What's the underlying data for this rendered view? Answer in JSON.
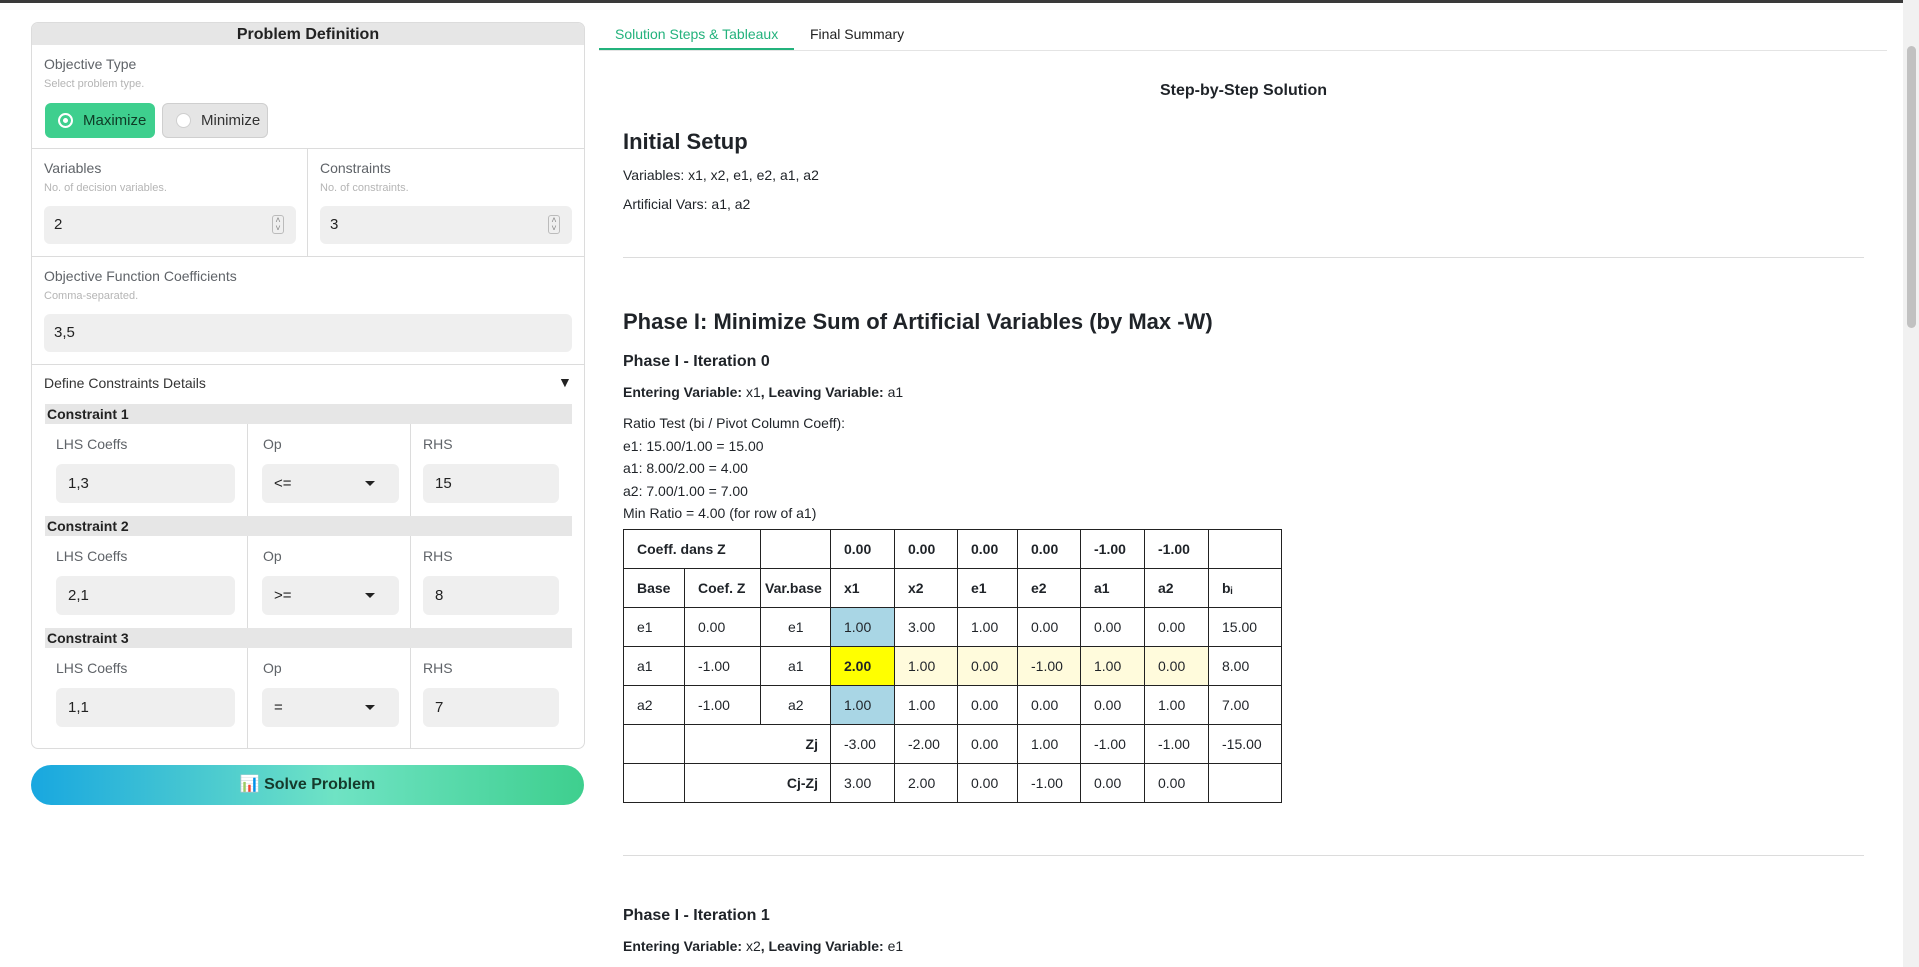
{
  "problem": {
    "title": "Problem Definition",
    "objective_type": {
      "label": "Objective Type",
      "hint": "Select problem type.",
      "maximize": "Maximize",
      "minimize": "Minimize",
      "selected": "Maximize"
    },
    "variables": {
      "label": "Variables",
      "hint": "No. of decision variables.",
      "value": "2"
    },
    "constraints": {
      "label": "Constraints",
      "hint": "No. of constraints.",
      "value": "3"
    },
    "objective_coeffs": {
      "label": "Objective Function Coefficients",
      "hint": "Comma-separated.",
      "value": "3,5"
    },
    "details_label": "Define Constraints Details",
    "details_toggle": "▼",
    "constraint_rows": [
      {
        "title": "Constraint 1",
        "lhs_label": "LHS Coeffs",
        "lhs": "1,3",
        "op_label": "Op",
        "op": "<=",
        "rhs_label": "RHS",
        "rhs": "15"
      },
      {
        "title": "Constraint 2",
        "lhs_label": "LHS Coeffs",
        "lhs": "2,1",
        "op_label": "Op",
        "op": ">=",
        "rhs_label": "RHS",
        "rhs": "8"
      },
      {
        "title": "Constraint 3",
        "lhs_label": "LHS Coeffs",
        "lhs": "1,1",
        "op_label": "Op",
        "op": "=",
        "rhs_label": "RHS",
        "rhs": "7"
      }
    ],
    "solve_button": "📊 Solve Problem"
  },
  "tabs": {
    "steps": "Solution Steps & Tableaux",
    "summary": "Final Summary",
    "active": "steps"
  },
  "solution": {
    "heading": "Step-by-Step Solution",
    "initial_setup": {
      "title": "Initial Setup",
      "variables": "Variables: x1, x2, e1, e2, a1, a2",
      "artificial": "Artificial Vars: a1, a2"
    },
    "phase1_title": "Phase I: Minimize Sum of Artificial Variables (by Max -W)",
    "iter0": {
      "title": "Phase I - Iteration 0",
      "entering_label": "Entering Variable:",
      "entering": "x1",
      "leaving_label": "Leaving Variable:",
      "leaving": "a1",
      "ratio_lines": [
        "Ratio Test (bi / Pivot Column Coeff):",
        "e1: 15.00/1.00 = 15.00",
        "a1: 8.00/2.00 = 4.00",
        "a2: 7.00/1.00 = 7.00",
        "Min Ratio = 4.00 (for row of a1)"
      ],
      "table": {
        "coeff_label": "Coeff. dans Z",
        "coeffs": [
          "0.00",
          "0.00",
          "0.00",
          "0.00",
          "-1.00",
          "-1.00"
        ],
        "headers": [
          "Base",
          "Coef. Z",
          "Var.base",
          "x1",
          "x2",
          "e1",
          "e2",
          "a1",
          "a2",
          "bᵢ"
        ],
        "rows": [
          [
            "e1",
            "0.00",
            "e1",
            "1.00",
            "3.00",
            "1.00",
            "0.00",
            "0.00",
            "0.00",
            "15.00"
          ],
          [
            "a1",
            "-1.00",
            "a1",
            "2.00",
            "1.00",
            "0.00",
            "-1.00",
            "1.00",
            "0.00",
            "8.00"
          ],
          [
            "a2",
            "-1.00",
            "a2",
            "1.00",
            "1.00",
            "0.00",
            "0.00",
            "0.00",
            "1.00",
            "7.00"
          ]
        ],
        "zj_label": "Zj",
        "zj": [
          "-3.00",
          "-2.00",
          "0.00",
          "1.00",
          "-1.00",
          "-1.00",
          "-15.00"
        ],
        "cjzj_label": "Cj-Zj",
        "cjzj": [
          "3.00",
          "2.00",
          "0.00",
          "-1.00",
          "0.00",
          "0.00",
          ""
        ]
      }
    },
    "iter1": {
      "title": "Phase I - Iteration 1",
      "entering_label": "Entering Variable:",
      "entering": "x2",
      "leaving_label": "Leaving Variable:",
      "leaving": "e1"
    }
  }
}
